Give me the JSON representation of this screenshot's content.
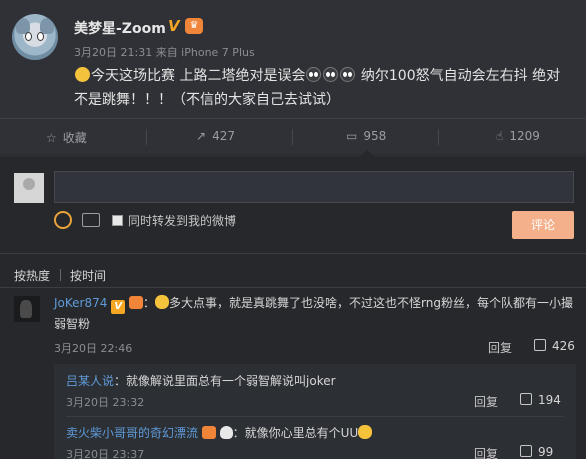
{
  "post": {
    "username": "美梦星-Zoom",
    "vbadge": "V",
    "meta": "3月20日 21:31 来自 iPhone 7 Plus",
    "text_part1": "今天这场比赛 上路二塔绝对是误会",
    "text_part2": " 纳尔100怒气自动会左右抖 绝对不是跳舞！！！（不信的大家自己去试试）"
  },
  "actions": {
    "favorite": "收藏",
    "forward_count": "427",
    "comment_count": "958",
    "like_count": "1209"
  },
  "composer": {
    "also_forward": "同时转发到我的微博",
    "submit": "评论"
  },
  "sort": {
    "hot": "按热度",
    "time": "按时间"
  },
  "comment": {
    "user": "JoKer874",
    "text": "多大点事，就是真跳舞了也没啥，不过这也不怪rng粉丝，每个队都有一小撮弱智粉",
    "time": "3月20日 22:46",
    "reply": "回复",
    "likes": "426",
    "replies": [
      {
        "user": "吕某人说",
        "text": "：就像解说里面总有一个弱智解说叫joker",
        "time": "3月20日 23:32",
        "reply": "回复",
        "likes": "194"
      },
      {
        "user": "卖火柴小哥哥的奇幻漂流",
        "text": "：就像你心里总有个UU",
        "time": "3月20日 23:37",
        "reply": "回复",
        "likes": "99"
      }
    ]
  }
}
